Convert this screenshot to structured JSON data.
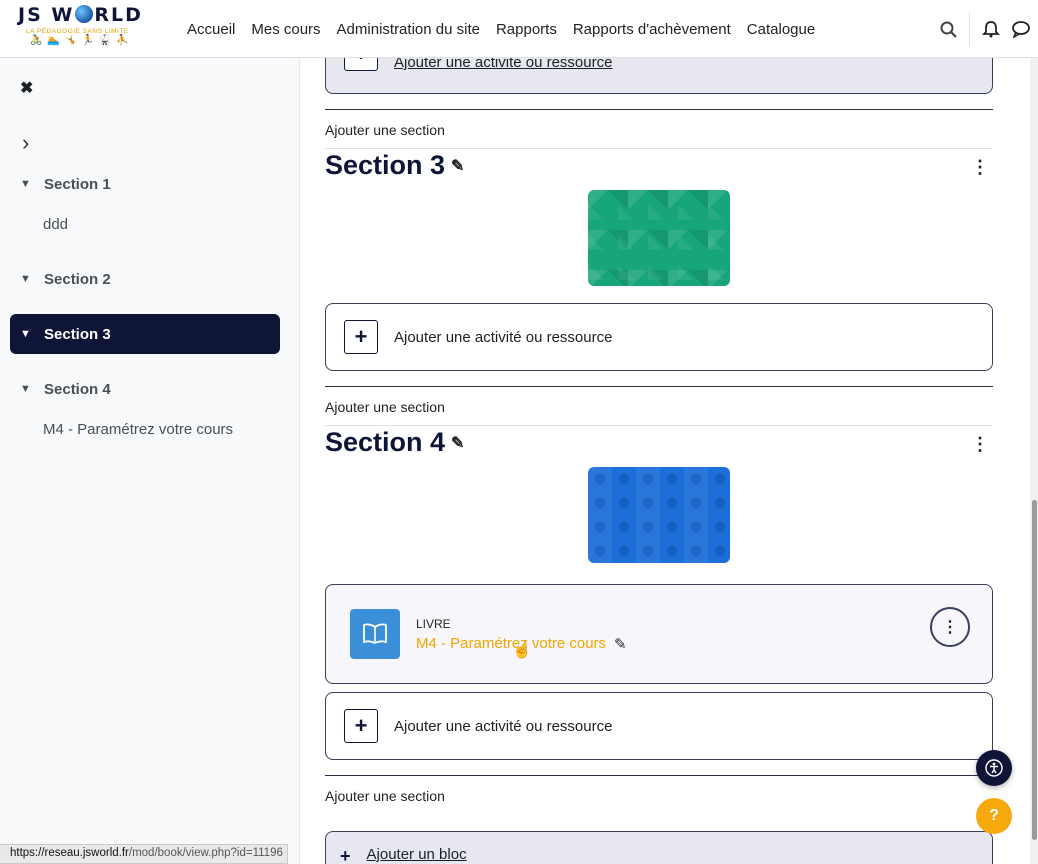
{
  "logo": {
    "line1": "JS W",
    "line1b": "RLD",
    "tagline": "LA PÉDAGOGIE SANS LIMITE",
    "figures": "🚴 🏊 🤸 🏃 🥋 ⛹"
  },
  "nav": {
    "items": [
      "Accueil",
      "Mes cours",
      "Administration du site",
      "Rapports",
      "Rapports d'achèvement",
      "Catalogue"
    ]
  },
  "icons": {
    "search": "🔍",
    "bell": "🔔",
    "chat": "💬",
    "close": "✖",
    "chevron_right": "›",
    "chevron_down": "⌄",
    "pencil": "✎",
    "kebab": "⋮",
    "plus": "+",
    "a11y": "♿",
    "help": "?",
    "cursor": "☝"
  },
  "drawer": {
    "sections": [
      {
        "label": "Section 1",
        "sub": "ddd"
      },
      {
        "label": "Section 2",
        "sub": ""
      },
      {
        "label": "Section 3",
        "sub": "",
        "active": true
      },
      {
        "label": "Section 4",
        "sub": "M4 - Paramétrez votre cours"
      }
    ]
  },
  "main": {
    "top_add_label": "Ajouter une activité ou ressource",
    "add_section_label": "Ajouter une section",
    "sections": [
      {
        "title": "Section 3",
        "image_color": "#17a57c",
        "add_activity": "Ajouter une activité ou ressource"
      },
      {
        "title": "Section 4",
        "image_color": "#1c6fd8",
        "add_activity": "Ajouter une activité ou ressource",
        "activity": {
          "type": "LIVRE",
          "name": "M4 - Paramétrez votre cours"
        }
      }
    ],
    "add_block_label": "Ajouter un bloc"
  },
  "status_bar": {
    "host": "https://reseau.jsworld.fr",
    "path": "/mod/book/view.php?id=11196"
  }
}
